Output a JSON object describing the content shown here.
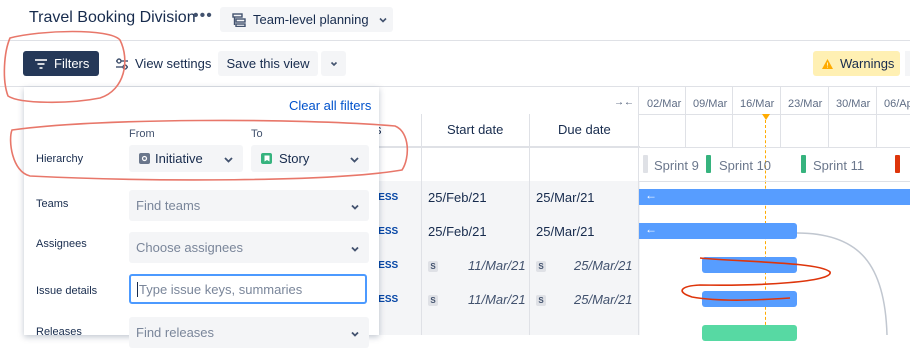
{
  "header": {
    "title": "Travel Booking Division",
    "more_label": "•••",
    "plan_button_label": "Team-level planning"
  },
  "toolbar": {
    "filters_label": "Filters",
    "view_settings_label": "View settings",
    "save_view_label": "Save this view",
    "warnings_label": "Warnings"
  },
  "table": {
    "col_partial": "s",
    "start_date_header": "Start date",
    "due_date_header": "Due date",
    "rows": [
      {
        "status": "RESS",
        "start": "25/Feb/21",
        "due": "25/Mar/21",
        "italic": false
      },
      {
        "status": "RESS",
        "start": "25/Feb/21",
        "due": "25/Mar/21",
        "italic": false
      },
      {
        "status": "RESS",
        "start": "11/Mar/21",
        "due": "25/Mar/21",
        "italic": true
      },
      {
        "status": "RESS",
        "start": "11/Mar/21",
        "due": "25/Mar/21",
        "italic": true
      }
    ],
    "s_badge": "S"
  },
  "timeline": {
    "dates": [
      "02/Mar",
      "09/Mar",
      "16/Mar",
      "23/Mar",
      "30/Mar",
      "06/Ap"
    ],
    "sprints": [
      "Sprint 9",
      "Sprint 10",
      "Sprint 11"
    ],
    "collapse_glyph": "→←",
    "arrow_glyph": "←"
  },
  "filter_panel": {
    "clear_label": "Clear all filters",
    "hierarchy_label": "Hierarchy",
    "from_label": "From",
    "to_label": "To",
    "from_value": "Initiative",
    "to_value": "Story",
    "teams_label": "Teams",
    "teams_placeholder": "Find teams",
    "assignees_label": "Assignees",
    "assignees_placeholder": "Choose assignees",
    "issue_details_label": "Issue details",
    "issue_details_placeholder": "Type issue keys, summaries",
    "releases_label": "Releases",
    "releases_placeholder": "Find releases"
  },
  "colors": {
    "primary_dark": "#253858",
    "bar_blue": "#579DFF",
    "bar_green": "#57D9A3",
    "warning_bg": "#FFF0B3",
    "annotation_red": "#E8776A",
    "today_line": "#FFAB00"
  }
}
